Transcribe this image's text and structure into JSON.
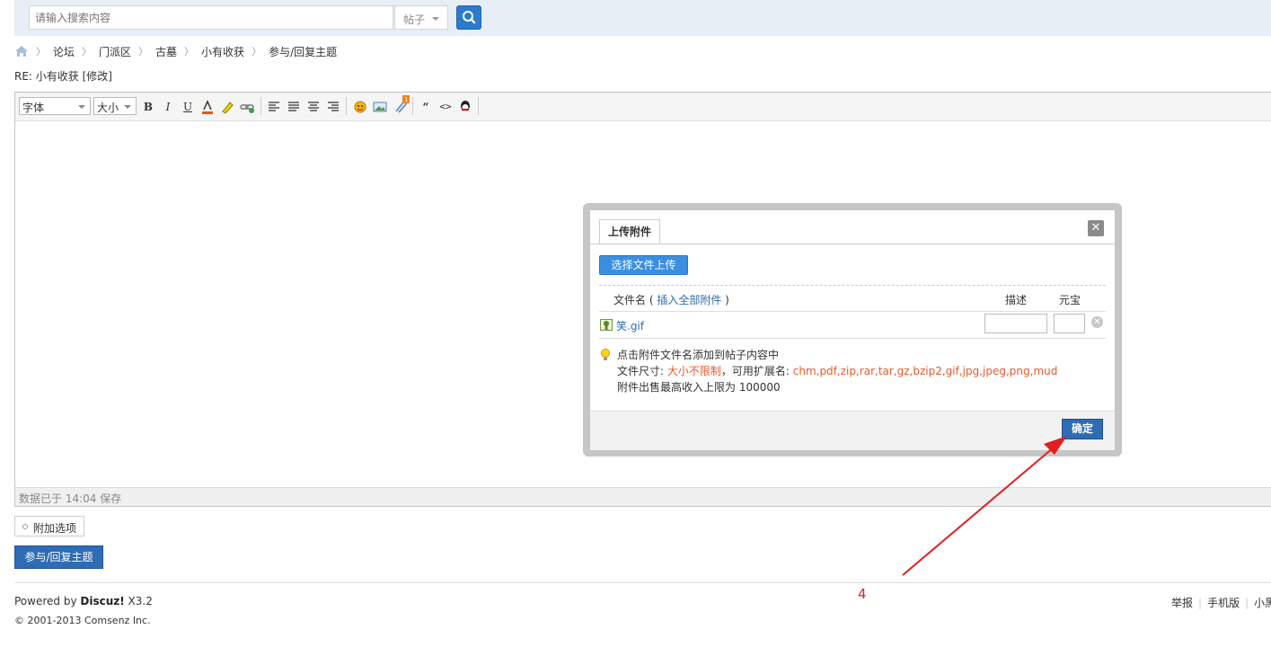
{
  "search": {
    "placeholder": "请输入搜索内容",
    "type_label": "帖子"
  },
  "breadcrumb": [
    "论坛",
    "门派区",
    "古墓",
    "小有收获",
    "参与/回复主题"
  ],
  "post_title": "RE: 小有收获 [修改]",
  "editor": {
    "font_label": "字体",
    "size_label": "大小",
    "status_text": "数据已于 14:04 保存"
  },
  "extra_options_label": "附加选项",
  "submit_label": "参与/回复主题",
  "dialog": {
    "tab_label": "上传附件",
    "choose_file_label": "选择文件上传",
    "col_filename_label": "文件名",
    "insert_all_label": "插入全部附件",
    "col_desc_label": "描述",
    "col_price_label": "元宝",
    "file_name": "笑.gif",
    "tip_line1": "点击附件文件名添加到帖子内容中",
    "tip_size_prefix": "文件尺寸: ",
    "tip_size_value": "大小不限制",
    "tip_ext_prefix": "，可用扩展名: ",
    "tip_ext_value": "chm,pdf,zip,rar,tar,gz,bzip2,gif,jpg,jpeg,png,mud",
    "tip_line3": "附件出售最高收入上限为 100000",
    "confirm_label": "确定"
  },
  "footer": {
    "powered_prefix": "Powered by ",
    "powered_brand": "Discuz!",
    "powered_version": " X3.2",
    "copyright": "© 2001-2013 Comsenz Inc.",
    "links": [
      "举报",
      "手机版",
      "小黑"
    ]
  },
  "annotation_number": "4",
  "colors": {
    "accent": "#2e6cb5",
    "annotation": "#e02020",
    "highlight_text": "#e85a2d"
  }
}
